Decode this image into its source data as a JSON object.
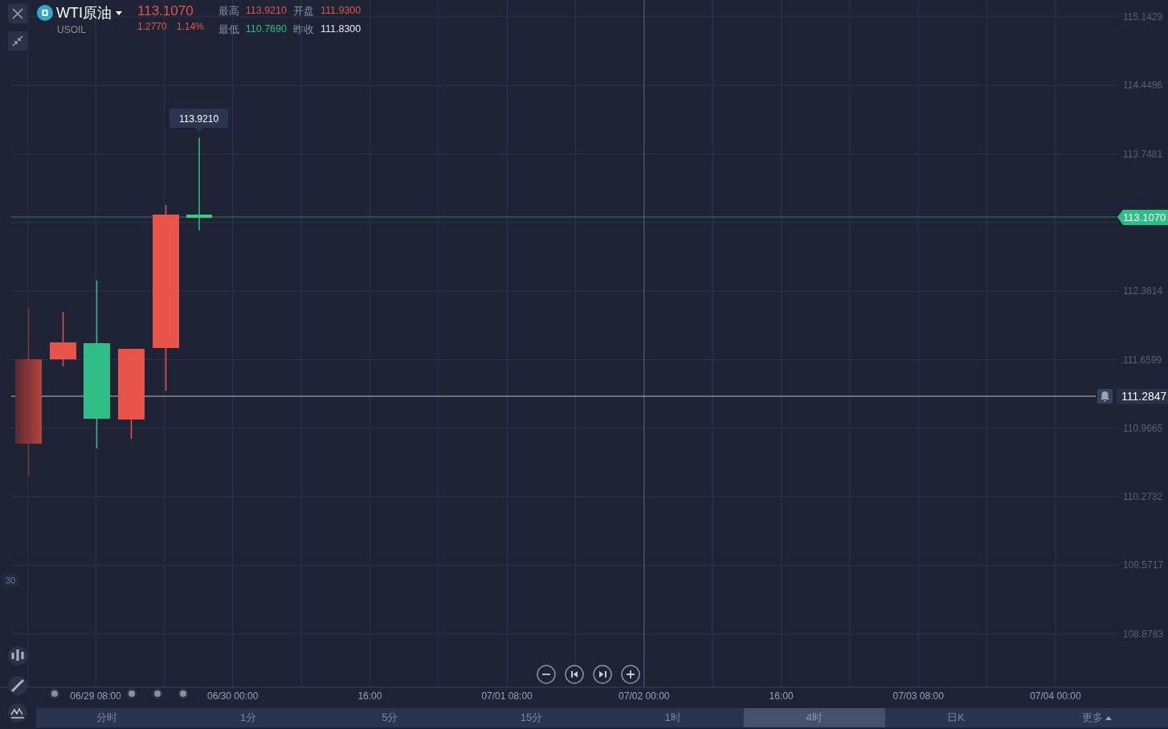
{
  "header": {
    "symbol": "WTI原油",
    "code": "USOIL",
    "price": "113.1070",
    "change": "1.2770",
    "change_pct": "1.14%",
    "stats": [
      {
        "label": "最高",
        "value": "113.9210",
        "color": "#e8534a"
      },
      {
        "label": "开盘",
        "value": "111.9300",
        "color": "#e8534a"
      },
      {
        "label": "最低",
        "value": "110.7690",
        "color": "#2fbd85"
      },
      {
        "label": "昨收",
        "value": "111.8300",
        "color": "#e6e8ee"
      }
    ]
  },
  "chart": {
    "price_labels": [
      "115.1429",
      "114.4496",
      "113.7481",
      "112.3614",
      "111.6599",
      "110.9665",
      "110.2732",
      "109.5717",
      "108.8783"
    ],
    "time_labels": [
      "06/29 08:00",
      "06/30 00:00",
      "16:00",
      "07/01 08:00",
      "07/02 00:00",
      "16:00",
      "07/03 08:00",
      "07/04 00:00"
    ],
    "current_price": "113.1070",
    "crosshair_price": "111.2847",
    "tooltip": "113.9210",
    "side_label": "30"
  },
  "period_tabs": [
    {
      "label": "分时",
      "selected": false
    },
    {
      "label": "1分",
      "selected": false
    },
    {
      "label": "5分",
      "selected": false
    },
    {
      "label": "15分",
      "selected": false
    },
    {
      "label": "1时",
      "selected": false
    },
    {
      "label": "4时",
      "selected": true
    },
    {
      "label": "日K",
      "selected": false
    },
    {
      "label": "更多",
      "selected": false,
      "kind": "menu"
    }
  ]
}
